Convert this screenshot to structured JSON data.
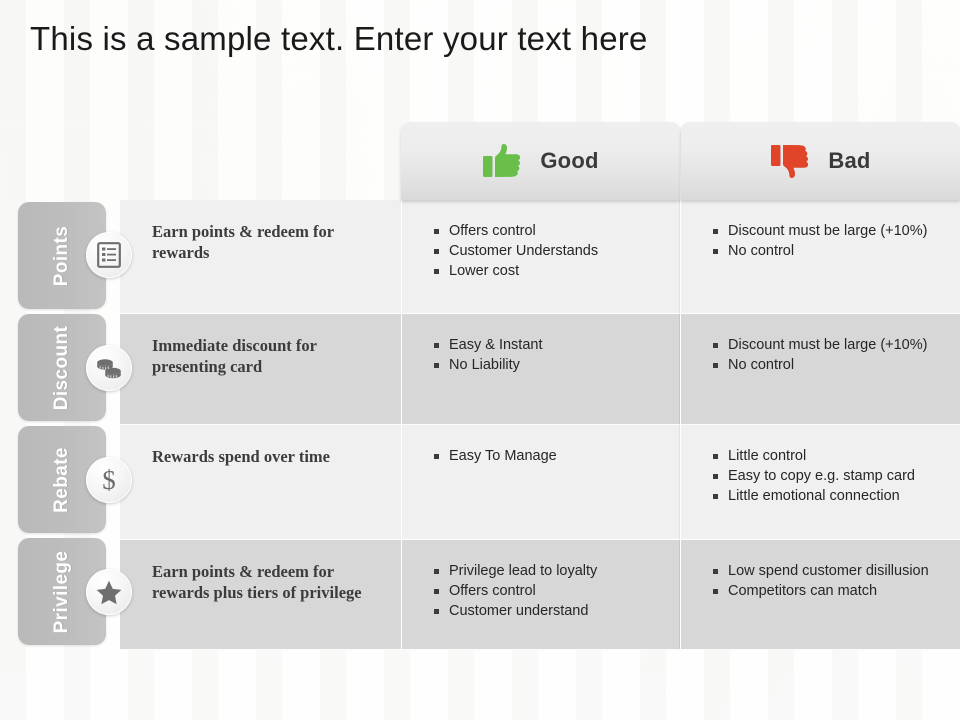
{
  "title": "This is a sample text. Enter your text here",
  "columns": {
    "description_header": "",
    "good": {
      "label": "Good",
      "icon": "thumbs-up-icon",
      "color": "#6ABF4B"
    },
    "bad": {
      "label": "Bad",
      "icon": "thumbs-down-icon",
      "color": "#E0452A"
    }
  },
  "rows": [
    {
      "category": "Points",
      "icon": "clipboard-list-icon",
      "description": "Earn points  & redeem for rewards",
      "good": [
        "Offers control",
        "Customer Understands",
        "Lower cost"
      ],
      "bad": [
        "Discount must be large (+10%)",
        "No control"
      ]
    },
    {
      "category": "Discount",
      "icon": "coins-icon",
      "description": "Immediate  discount for presenting  card",
      "good": [
        "Easy & Instant",
        "No Liability"
      ],
      "bad": [
        "Discount  must be large (+10%)",
        "No control"
      ]
    },
    {
      "category": "Rebate",
      "icon": "dollar-sign-icon",
      "description": "Rewards spend over time",
      "good": [
        "Easy To Manage"
      ],
      "bad": [
        "Little control",
        "Easy to copy e.g. stamp card",
        "Little emotional connection"
      ]
    },
    {
      "category": "Privilege",
      "icon": "star-icon",
      "description": "Earn points  & redeem for rewards plus  tiers of privilege",
      "good": [
        "Privilege lead to loyalty",
        "Offers control",
        "Customer understand"
      ],
      "bad": [
        "Low spend customer disillusion",
        "Competitors can match"
      ]
    }
  ],
  "colors": {
    "row_light": "#F0F0F0",
    "row_dark": "#D7D7D7",
    "tab_gray": "#BDBDBD",
    "header_gray": "#E7E7E7",
    "text_dark": "#3C3C3C"
  }
}
